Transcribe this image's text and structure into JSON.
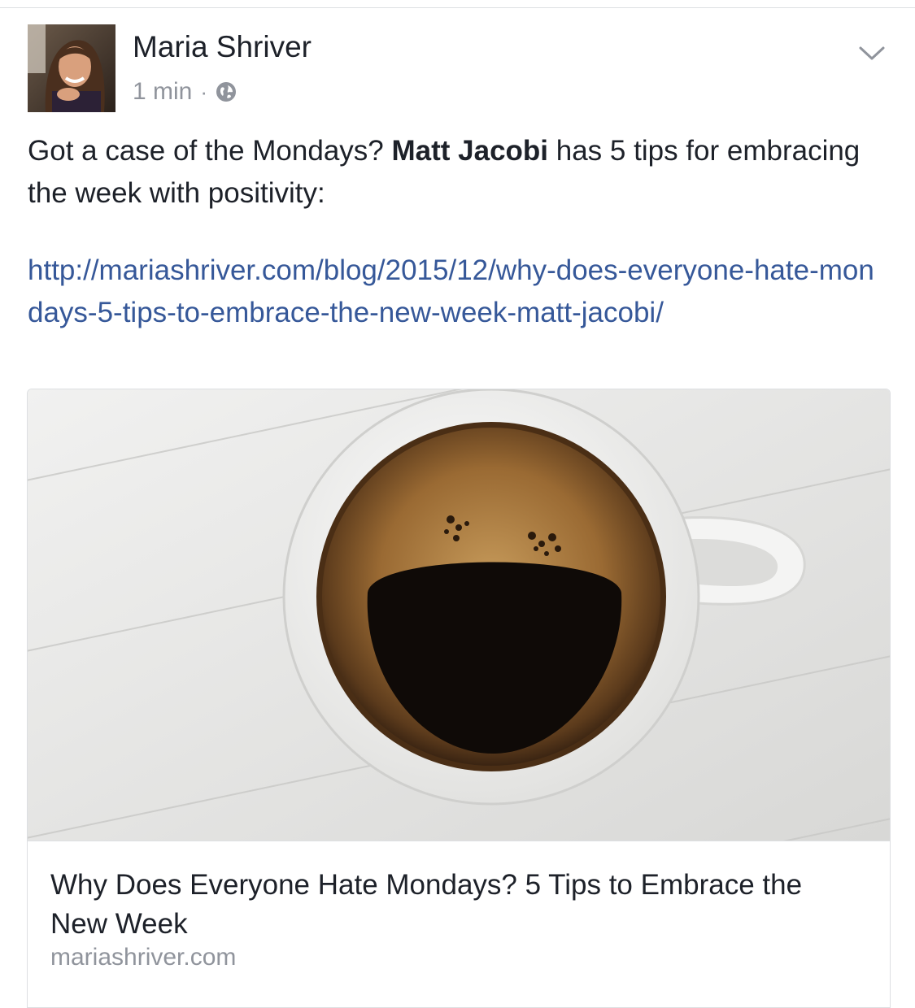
{
  "post": {
    "author": "Maria Shriver",
    "time": "1 min",
    "separator": "·",
    "privacy_icon": "globe-icon",
    "menu_icon": "chevron-down-icon",
    "text_before": "Got a case of the Mondays? ",
    "mention": "Matt Jacobi",
    "text_after": " has 5 tips for embracing the week with positivity:",
    "link": "http://mariashriver.com/blog/2015/12/why-does-everyone-hate-mondays-5-tips-to-embrace-the-new-week-matt-jacobi/"
  },
  "link_preview": {
    "image_subject": "smiley-face-coffee-cup",
    "title": "Why Does Everyone Hate Mondays? 5 Tips to Embrace the New Week",
    "domain": "mariashriver.com"
  },
  "colors": {
    "text": "#1d2129",
    "link": "#365899",
    "meta": "#90949c",
    "border": "#dddfe2"
  }
}
